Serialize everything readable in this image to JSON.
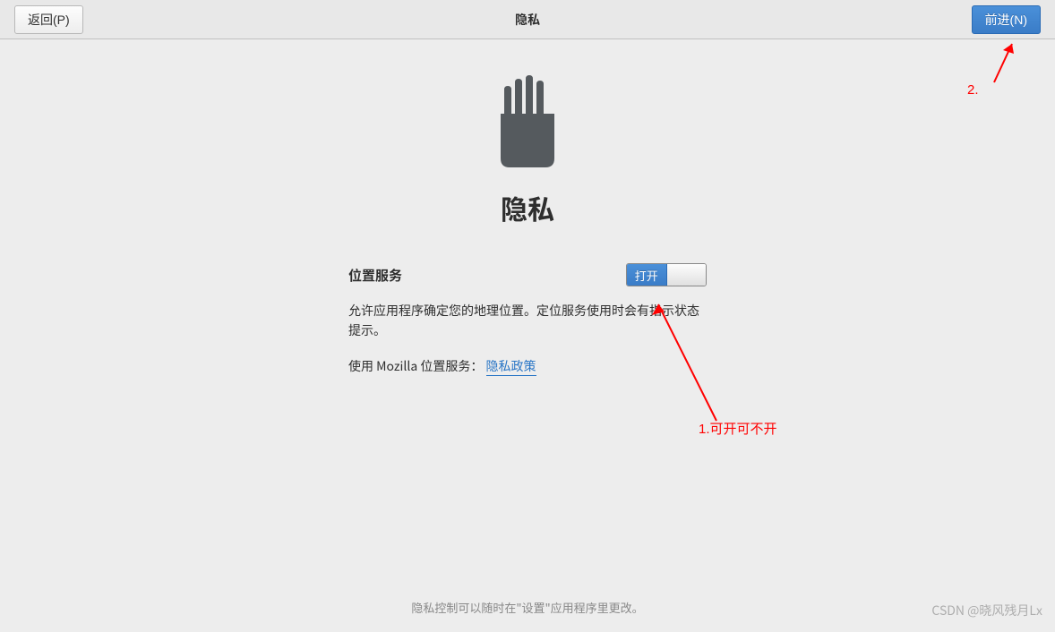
{
  "header": {
    "back_label": "返回(P)",
    "title": "隐私",
    "next_label": "前进(N)"
  },
  "main": {
    "heading": "隐私",
    "settings": {
      "location": {
        "label": "位置服务",
        "toggle_on_text": "打开",
        "description": "允许应用程序确定您的地理位置。定位服务使用时会有指示状态提示。",
        "policy_prefix": "使用 Mozilla 位置服务：",
        "policy_link_text": "隐私政策"
      }
    }
  },
  "footer": {
    "text": "隐私控制可以随时在\"设置\"应用程序里更改。"
  },
  "annotations": {
    "note1": "1.可开可不开",
    "note2": "2."
  },
  "watermark": "CSDN @晓风残月Lx",
  "colors": {
    "accent": "#4a90d9",
    "link": "#2a76c6",
    "annotation": "#ff0000"
  }
}
